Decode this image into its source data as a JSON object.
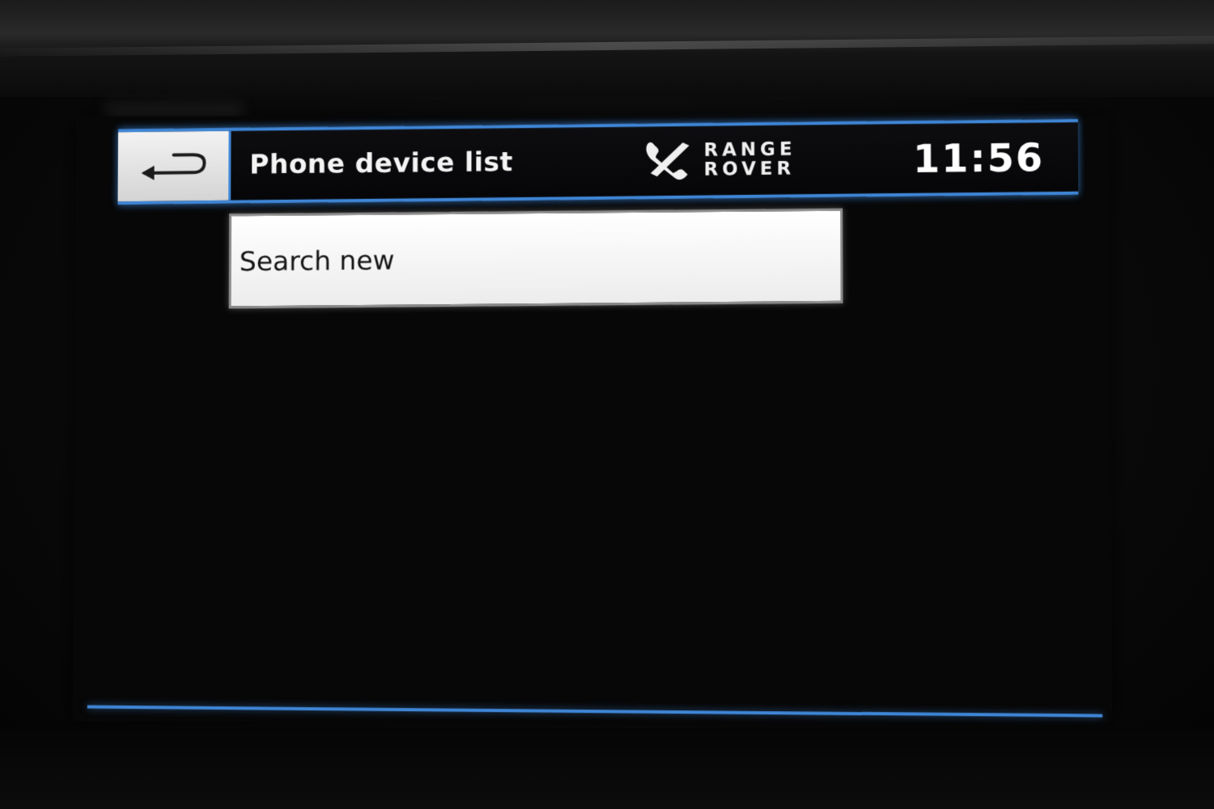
{
  "header": {
    "title": "Phone device list",
    "clock": "11:56",
    "logo": {
      "line1": "RANGE",
      "line2": "ROVER",
      "icon": "phone-handset-icon"
    },
    "back_icon": "back-arrow-icon"
  },
  "list": {
    "items": [
      {
        "label": "Search new",
        "selected": true
      }
    ]
  },
  "colors": {
    "accent": "#3f86d6",
    "background": "#070707",
    "selected_item_bg": "#ffffff",
    "text_on_dark": "#f4f4f4",
    "text_on_light": "#161616"
  }
}
